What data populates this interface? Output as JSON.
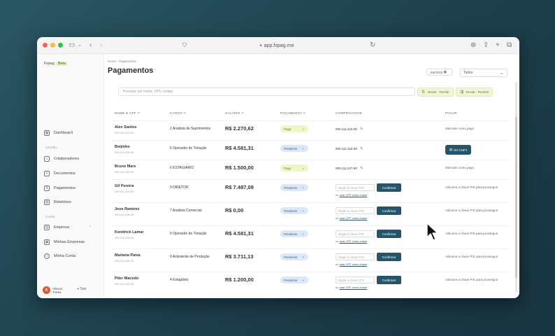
{
  "browser": {
    "url": "app.fopag.me",
    "traffic_colors": [
      "#fe5f57",
      "#febc2e",
      "#28c840"
    ],
    "icons": [
      "sidebar-icon",
      "back-icon",
      "forward-icon",
      "shield-icon",
      "lock-icon",
      "reload-icon",
      "download-icon",
      "share-icon",
      "plus-icon",
      "tabs-icon"
    ]
  },
  "sidebar": {
    "logo": "Fopag",
    "logo_tag": "Beta",
    "nav": [
      {
        "label": "Dashboard",
        "icon": "dashboard-icon"
      },
      {
        "label": "Gestão",
        "section": true
      },
      {
        "label": "Colaboradores",
        "icon": "users-icon"
      },
      {
        "label": "Documentos",
        "icon": "document-icon"
      },
      {
        "label": "Pagamentos",
        "icon": "wallet-icon"
      },
      {
        "label": "Relatórios",
        "icon": "calendar-icon"
      },
      {
        "label": "Conta",
        "section": true
      },
      {
        "label": "Empresa",
        "icon": "building-icon"
      },
      {
        "label": "Minhas Empresas",
        "icon": "briefcase-icon"
      },
      {
        "label": "Minha Conta",
        "icon": "user-icon"
      }
    ],
    "user": {
      "initial": "A",
      "name": "Alisson Torres",
      "logout": "Sair"
    }
  },
  "main": {
    "breadcrumb": "Home  ›  Pagamentos",
    "title": "Pagamentos",
    "date": "Jan/2023",
    "status_select": "Todos",
    "search_placeholder": "Procurar por nome, CPF, código",
    "actions": [
      "Dividir - Remitir",
      "Enviar - Remittir"
    ],
    "columns": [
      "NOME E CPF",
      "CARGO",
      "SALÁRIO",
      "PAGAMENTO",
      "COMPROVANTE",
      "PAGAR"
    ],
    "rows": [
      {
        "name": "Alex Santos",
        "cpf": "000.111.222-00",
        "cargo": "2 Analista de Suprimentos",
        "salario": "R$ 2.270,62",
        "status": "Pago",
        "comp": "000.111.222-00",
        "pagar": "Marcado como pago",
        "type": "paid"
      },
      {
        "name": "Beijinho",
        "cpf": "000.111.226-99",
        "cargo": "6 Operador de Tiotação",
        "salario": "R$ 4.581,31",
        "status": "Pendente",
        "comp": "000.111.218-06",
        "pagar": "Ver CNPJ",
        "type": "ver"
      },
      {
        "name": "Bruno Mars",
        "cpf": "000.111.229-00",
        "cargo": "6 ESTAGIÁRIO",
        "salario": "R$ 1.500,00",
        "status": "Pago",
        "comp": "000.111.227-90",
        "pagar": "Marcado como pago",
        "type": "paid"
      },
      {
        "name": "Gil Pereira",
        "cpf": "000.111.222-05",
        "cargo": "9 DIRETOR",
        "salario": "R$ 7.487,08",
        "status": "Pendente",
        "comp": "Digite a chave PIX",
        "pagar": "Adicione a chave PIX para prosseguir",
        "type": "pix"
      },
      {
        "name": "Jose Ramirez",
        "cpf": "000.111.226-06",
        "cargo": "7 Analista Comercial",
        "salario": "R$ 0,00",
        "status": "Pendente",
        "comp": "Digite a chave PIX",
        "pagar": "Adicione a chave PIX para prosseguir",
        "type": "pix"
      },
      {
        "name": "Kendrick Lamar",
        "cpf": "000.111.225-05",
        "cargo": "0 Operador de Tiotação",
        "salario": "R$ 4.581,31",
        "status": "Pendente",
        "comp": "Digite a chave PIX",
        "pagar": "Adicione a chave PIX para prosseguir",
        "type": "pix"
      },
      {
        "name": "Mariana Paiva",
        "cpf": "000.111.222-10",
        "cargo": "9 Assistente de Produção",
        "salario": "R$ 3.711,13",
        "status": "Pendente",
        "comp": "Digite a chave PIX",
        "pagar": "Adicione a chave PIX para prosseguir",
        "type": "pix"
      },
      {
        "name": "Piter Macedo",
        "cpf": "000.111.222-04",
        "cargo": "4 Estagiário",
        "salario": "R$ 1.200,00",
        "status": "Pendente",
        "comp": "Digite a chave PIX",
        "pagar": "Adicione a chave PIX para prosseguir",
        "type": "pix"
      }
    ],
    "confirm_label": "Confirmar",
    "use_cpf_prefix": "ou",
    "use_cpf_link": "usar CPF como chave"
  },
  "colors": {
    "primary": "#25556a",
    "pago_bg": "#eef6c8",
    "pendente_bg": "#dde8f7",
    "background": "#1d3f4b"
  }
}
